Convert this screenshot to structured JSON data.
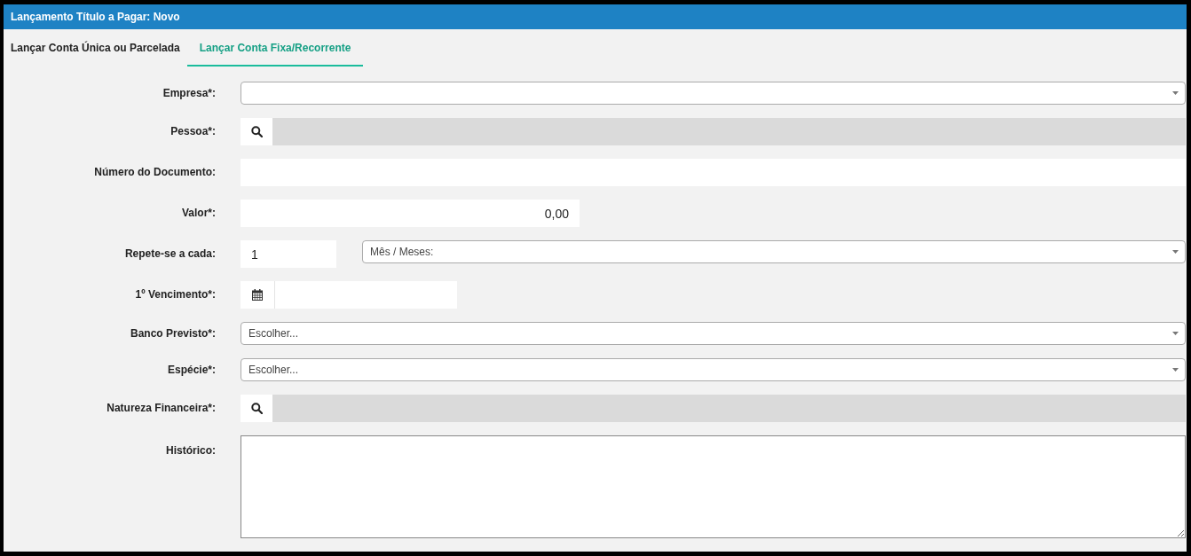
{
  "window": {
    "title": "Lançamento Título a Pagar: Novo"
  },
  "tabs": [
    {
      "label": "Lançar Conta Única ou Parcelada",
      "selected": false
    },
    {
      "label": "Lançar Conta Fixa/Recorrente",
      "selected": true
    }
  ],
  "fields": [
    {
      "kind": "select",
      "label": "Empresa*:"
    },
    {
      "kind": "lookup",
      "label": "Pessoa*:"
    },
    {
      "kind": "text",
      "label": "Número do Documento:"
    },
    {
      "kind": "number",
      "label": "Valor*:",
      "value": "0,00"
    },
    {
      "kind": "repeat",
      "label": "Repete-se a cada:",
      "value": "1",
      "option": "Mês / Meses:"
    },
    {
      "kind": "date",
      "label": "1º Vencimento*:"
    },
    {
      "kind": "select",
      "label": "Banco Previsto*:",
      "option": "Escolher..."
    },
    {
      "kind": "select",
      "label": "Espécie*:",
      "option": "Escolher..."
    },
    {
      "kind": "lookup",
      "label": "Natureza Financeira*:"
    },
    {
      "kind": "textarea",
      "label": "Histórico:"
    }
  ]
}
